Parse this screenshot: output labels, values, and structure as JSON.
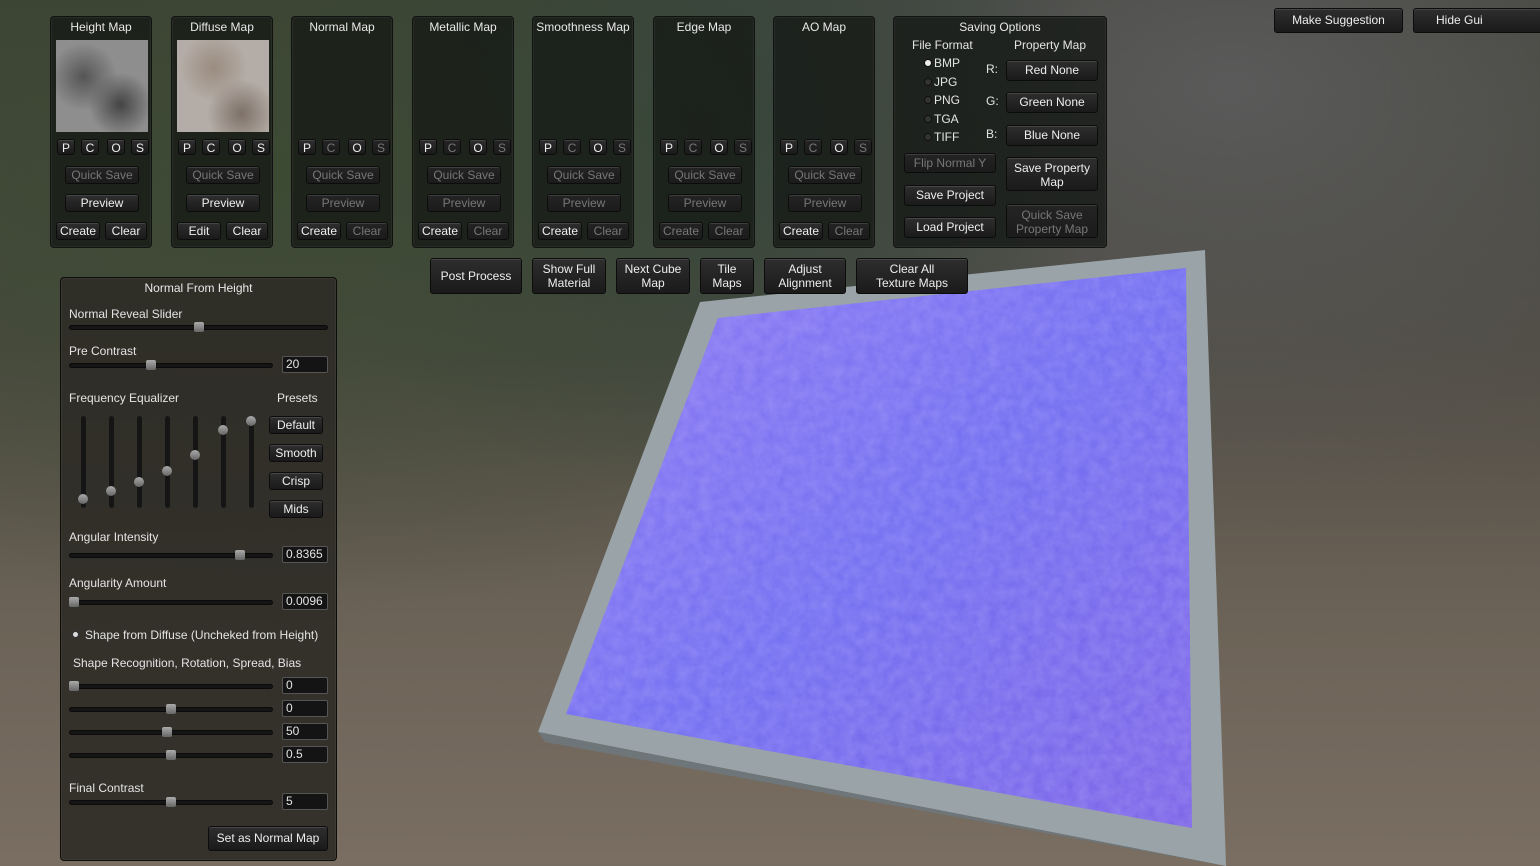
{
  "colors": {
    "panel": "#1a1e1a",
    "normal_map_base": "#7b6ef0",
    "frame": "#9aa3a7"
  },
  "map_panels": [
    {
      "title": "Height Map",
      "thumb": "height",
      "buttons": {
        "P": true,
        "C": true,
        "O": true,
        "S": true
      },
      "quick_save": {
        "label": "Quick Save",
        "enabled": false
      },
      "preview": {
        "label": "Preview",
        "enabled": true
      },
      "create": {
        "label": "Create",
        "enabled": true
      },
      "clear": {
        "label": "Clear",
        "enabled": true
      }
    },
    {
      "title": "Diffuse Map",
      "thumb": "diffuse",
      "buttons": {
        "P": true,
        "C": true,
        "O": true,
        "S": true
      },
      "quick_save": {
        "label": "Quick Save",
        "enabled": false
      },
      "preview": {
        "label": "Preview",
        "enabled": true
      },
      "create": {
        "label": "Edit",
        "enabled": true
      },
      "clear": {
        "label": "Clear",
        "enabled": true
      }
    },
    {
      "title": "Normal Map",
      "thumb": "",
      "buttons": {
        "P": true,
        "C": false,
        "O": true,
        "S": false
      },
      "quick_save": {
        "label": "Quick Save",
        "enabled": false
      },
      "preview": {
        "label": "Preview",
        "enabled": false
      },
      "create": {
        "label": "Create",
        "enabled": true
      },
      "clear": {
        "label": "Clear",
        "enabled": false
      }
    },
    {
      "title": "Metallic Map",
      "thumb": "",
      "buttons": {
        "P": true,
        "C": false,
        "O": true,
        "S": false
      },
      "quick_save": {
        "label": "Quick Save",
        "enabled": false
      },
      "preview": {
        "label": "Preview",
        "enabled": false
      },
      "create": {
        "label": "Create",
        "enabled": true
      },
      "clear": {
        "label": "Clear",
        "enabled": false
      }
    },
    {
      "title": "Smoothness Map",
      "thumb": "",
      "buttons": {
        "P": true,
        "C": false,
        "O": true,
        "S": false
      },
      "quick_save": {
        "label": "Quick Save",
        "enabled": false
      },
      "preview": {
        "label": "Preview",
        "enabled": false
      },
      "create": {
        "label": "Create",
        "enabled": true
      },
      "clear": {
        "label": "Clear",
        "enabled": false
      }
    },
    {
      "title": "Edge Map",
      "thumb": "",
      "buttons": {
        "P": true,
        "C": false,
        "O": true,
        "S": false
      },
      "quick_save": {
        "label": "Quick Save",
        "enabled": false
      },
      "preview": {
        "label": "Preview",
        "enabled": false
      },
      "create": {
        "label": "Create",
        "enabled": false
      },
      "clear": {
        "label": "Clear",
        "enabled": false
      }
    },
    {
      "title": "AO Map",
      "thumb": "",
      "buttons": {
        "P": true,
        "C": false,
        "O": true,
        "S": false
      },
      "quick_save": {
        "label": "Quick Save",
        "enabled": false
      },
      "preview": {
        "label": "Preview",
        "enabled": false
      },
      "create": {
        "label": "Create",
        "enabled": true
      },
      "clear": {
        "label": "Clear",
        "enabled": false
      }
    }
  ],
  "saving": {
    "title": "Saving Options",
    "file_format_label": "File Format",
    "property_map_label": "Property Map",
    "formats": [
      "BMP",
      "JPG",
      "PNG",
      "TGA",
      "TIFF"
    ],
    "selected_format": "BMP",
    "r_label": "R:",
    "g_label": "G:",
    "b_label": "B:",
    "red": "Red None",
    "green": "Green None",
    "blue": "Blue None",
    "flip_normal": "Flip Normal Y",
    "save_project": "Save Project",
    "load_project": "Load Project",
    "save_property": "Save Property Map",
    "quick_save_property": "Quick Save Property Map"
  },
  "top_right": {
    "suggestion": "Make Suggestion",
    "hide_gui": "Hide Gui"
  },
  "toolbar": {
    "post_process": "Post Process",
    "show_full": "Show Full Material",
    "next_cube": "Next Cube Map",
    "tile_maps": "Tile Maps",
    "adjust": "Adjust Alignment",
    "clear_all": "Clear All Texture Maps"
  },
  "nfh": {
    "title": "Normal From Height",
    "reveal_label": "Normal Reveal Slider",
    "reveal_value": 0.5,
    "pre_contrast_label": "Pre Contrast",
    "pre_contrast_pos": 0.4,
    "pre_contrast": "20",
    "eq_label": "Frequency Equalizer",
    "presets_label": "Presets",
    "eq_values": [
      0.1,
      0.18,
      0.28,
      0.4,
      0.58,
      0.85,
      0.95
    ],
    "presets": [
      "Default",
      "Smooth",
      "Crisp",
      "Mids"
    ],
    "angular_intensity_label": "Angular Intensity",
    "angular_intensity_pos": 0.84,
    "angular_intensity": "0.8365",
    "angularity_label": "Angularity Amount",
    "angularity_pos": 0.02,
    "angularity": "0.0096",
    "shape_checkbox": "Shape from Diffuse (Uncheked from Height)",
    "shape_checked": true,
    "shape_label": "Shape Recognition, Rotation, Spread, Bias",
    "shape_sliders": [
      {
        "pos": 0.02,
        "value": "0"
      },
      {
        "pos": 0.5,
        "value": "0"
      },
      {
        "pos": 0.48,
        "value": "50"
      },
      {
        "pos": 0.5,
        "value": "0.5"
      }
    ],
    "final_contrast_label": "Final Contrast",
    "final_contrast_pos": 0.5,
    "final_contrast": "5",
    "set_normal": "Set as Normal Map"
  }
}
